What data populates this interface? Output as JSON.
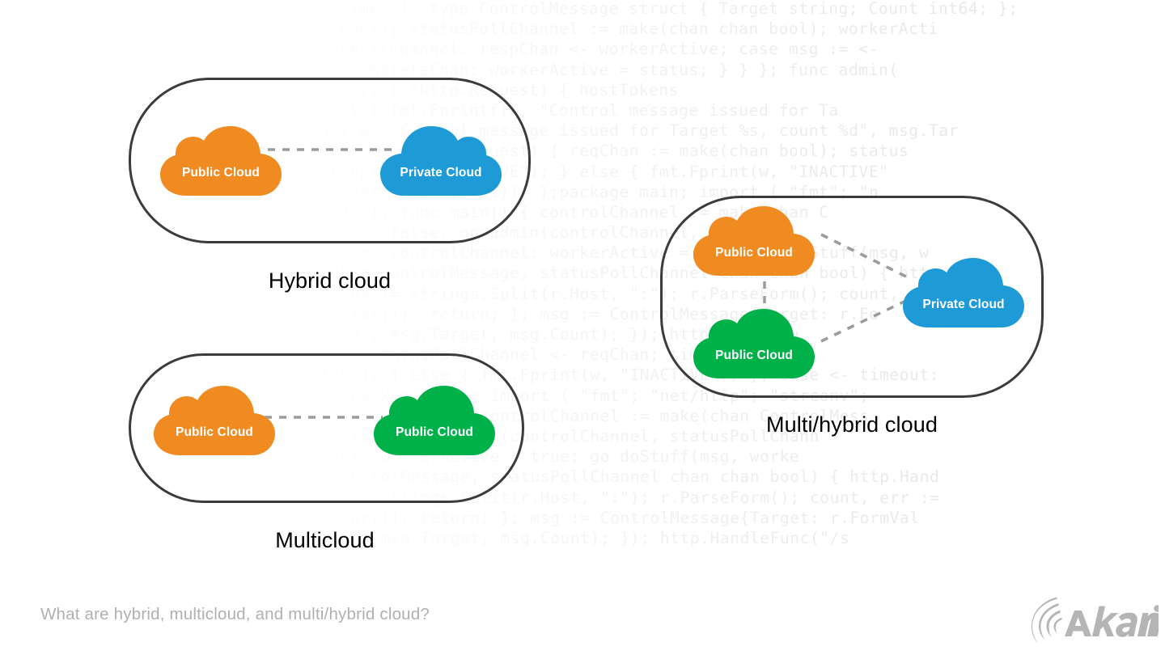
{
  "page": {
    "background_color": "#ffffff",
    "footer_caption": "What are hybrid, multicloud, and multi/hybrid cloud?",
    "footer_caption_color": "#b0b0b0",
    "logo_name": "Akamai",
    "logo_color": "#b5b5b5"
  },
  "colors": {
    "public_cloud_orange": "#F08B21",
    "public_cloud_green": "#00B14A",
    "private_cloud_blue": "#1E9BD7",
    "box_border": "#3b3b3b",
    "connector": "#9b9b9b",
    "label_text": "#ffffff",
    "caption_text": "#000000",
    "code_text": "#e9e9e9"
  },
  "diagrams": [
    {
      "id": "hybrid-cloud",
      "caption": "Hybrid cloud",
      "nodes": [
        {
          "id": "hybrid-public",
          "label": "Public Cloud",
          "color": "#F08B21",
          "flip": false
        },
        {
          "id": "hybrid-private",
          "label": "Private Cloud",
          "color": "#1E9BD7",
          "flip": true
        }
      ],
      "connections": [
        {
          "from": "hybrid-public",
          "to": "hybrid-private",
          "style": "dashed"
        }
      ]
    },
    {
      "id": "multicloud",
      "caption": "Multicloud",
      "nodes": [
        {
          "id": "multi-public-1",
          "label": "Public Cloud",
          "color": "#F08B21",
          "flip": false
        },
        {
          "id": "multi-public-2",
          "label": "Public Cloud",
          "color": "#00B14A",
          "flip": false
        }
      ],
      "connections": [
        {
          "from": "multi-public-1",
          "to": "multi-public-2",
          "style": "dashed"
        }
      ]
    },
    {
      "id": "multi-hybrid-cloud",
      "caption": "Multi/hybrid cloud",
      "nodes": [
        {
          "id": "mh-public-orange",
          "label": "Public Cloud",
          "color": "#F08B21",
          "flip": false
        },
        {
          "id": "mh-public-green",
          "label": "Public Cloud",
          "color": "#00B14A",
          "flip": false
        },
        {
          "id": "mh-private",
          "label": "Private Cloud",
          "color": "#1E9BD7",
          "flip": false
        }
      ],
      "connections": [
        {
          "from": "mh-public-orange",
          "to": "mh-private",
          "style": "dashed"
        },
        {
          "from": "mh-public-green",
          "to": "mh-private",
          "style": "dashed"
        },
        {
          "from": "mh-public-orange",
          "to": "mh-public-green",
          "style": "dashed"
        }
      ]
    }
  ],
  "code_background": {
    "language": "go",
    "lines": [
      "et/http\" ; \"strconv\"; \"strings\"; \"time\" ); type ControlMessage struct { Target string; Count int64; };",
      "ne); workerCompleteChan := make(chan bool); statusPollChannel := make(chan chan bool); workerActi",
      "for { select { case respChan := <- statusPollChannel: respChan <- workerActive; case msg := <-",
      "orkerCompleteChan); case status := <- workerCompleteChan: workerActive = status; } } }; func admin(",
      "p.HandleFunc(\"/admin\", func(w http.ResponseWriter, r *http.Request) { hostTokens",
      "rseInt(r.FormValue(\"count\"), 10, 64); if err != nil { fmt.Fprintf(w, \"Control message issued for Ta",
      "rget, count); cc <- msg; fmt.Fprintf(w, \"Control message issued for Target %s, count %d\", msg.Tar",
      "nc(\"/status\", func(w http.ResponseWriter, r *http.Request) { reqChan := make(chan bool); status",
      "ase result := <- reqChan; if result { fmt.Fprint(w, \"ACTIVE\"); } else { fmt.Fprint(w, \"INACTIVE\"",
      "\"INACTIVE\"); } }; log.Fatal(http.ListenAndServe(\":1337\", nil)); };package main; import ( \"fmt\"; \"n",
      "ntrolMessage struct { Target string; Count int64; }; func main() { controlChannel := make(chan C",
      "usPollChannel := make(chan chan bool); workerActive := false; go admin(controlChannel, statusPol",
      "respChan <- workerActive; case msg := <- controlChannel: workerActive = true; go doStuff(msg, w",
      "Active = status; } } }; func admin(cc chan ControlMessage, statusPollChannel chan chan bool) { htt",
      "ResponseWriter, r *http.Request) { hostTokens := strings.Split(r.Host, \":\"); r.ParseForm(); count,",
      "10, 64); if err != nil { fmt.Fprintf(w, err.Error()); return; }; msg := ControlMessage{Target: r.Fo",
      "w, \"Control message issued for Target %s, count %d\", msg.Target, msg.Count); }); http.HandleFu",
      "riter, r *http.Request) { reqChan := make(chan bool); statusPollChannel <- reqChan; timeout := ti",
      "han; if result { fmt.Fprint(w, \"ACTIVE\"); } else { fmt.Fprint(w, \"INACTIVE\"); }; case <- timeout:",
      "al(http.ListenAndServe(\":1337\", nil)); };package main; import ( \"fmt\"; \"net/http\"; \"strconv\";",
      "ge struct { Target string; Count int64; }; func main() { controlChannel := make(chan ControlMess",
      "annel := make(chan chan bool); workerActive := false; go admin(controlChannel, statusPollChann",
      "Chan <- workerActive; case msg := <- controlChannel: workerActive = true; go doStuff(msg, worke",
      "status; } } }; func admin(cc chan ControlMessage, statusPollChannel chan chan bool) { http.Hand",
      "eWriter, r *http.Request) { hostTokens := strings.Split(r.Host, \":\"); r.ParseForm(); count, err :=",
      "4); if err != nil { fmt.Fprintf(w, err.Error()); return; }; msg := ControlMessage{Target: r.FormVal",
      "ontrol message issued for Target %s, count %d\", msg.Target, msg.Count); }); http.HandleFunc(\"/s"
    ]
  }
}
